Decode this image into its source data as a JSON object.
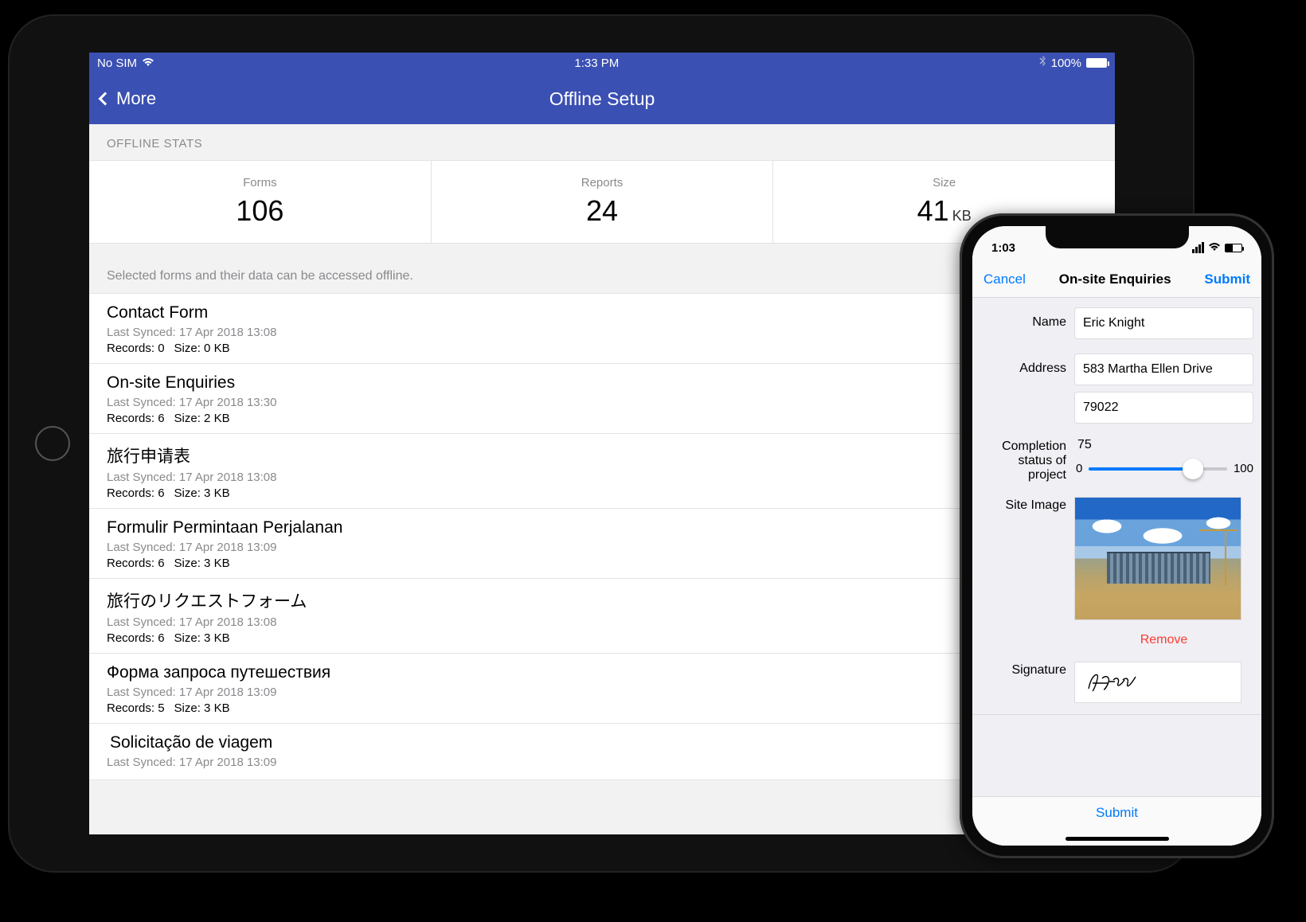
{
  "ipad": {
    "status": {
      "carrier": "No SIM",
      "time": "1:33 PM",
      "battery": "100%"
    },
    "nav": {
      "back": "More",
      "title": "Offline Setup"
    },
    "sectionHeader": "OFFLINE STATS",
    "stats": {
      "formsLabel": "Forms",
      "formsValue": "106",
      "reportsLabel": "Reports",
      "reportsValue": "24",
      "sizeLabel": "Size",
      "sizeValue": "41",
      "sizeUnit": "KB"
    },
    "helperText": "Selected forms and their data can be accessed offline.",
    "forms": [
      {
        "title": "Contact Form",
        "sync": "Last Synced: 17 Apr 2018 13:08",
        "records": "Records: 0",
        "size": "Size:   0 KB"
      },
      {
        "title": "On-site Enquiries",
        "sync": "Last Synced: 17 Apr 2018 13:30",
        "records": "Records: 6",
        "size": "Size:   2 KB"
      },
      {
        "title": "旅行申请表",
        "sync": "Last Synced: 17 Apr 2018 13:08",
        "records": "Records: 6",
        "size": "Size:   3 KB"
      },
      {
        "title": "Formulir Permintaan Perjalanan",
        "sync": "Last Synced: 17 Apr 2018 13:09",
        "records": "Records: 6",
        "size": "Size:   3 KB"
      },
      {
        "title": "旅行のリクエストフォーム",
        "sync": "Last Synced: 17 Apr 2018 13:08",
        "records": "Records: 6",
        "size": "Size:   3 KB"
      },
      {
        "title": "Форма запроса путешествия",
        "sync": "Last Synced: 17 Apr 2018 13:09",
        "records": "Records: 5",
        "size": "Size:   3 KB"
      },
      {
        "title": "Solicitação de viagem",
        "sync": "Last Synced: 17 Apr 2018 13:09",
        "records": "",
        "size": ""
      }
    ]
  },
  "iphone": {
    "status": {
      "time": "1:03"
    },
    "nav": {
      "cancel": "Cancel",
      "title": "On-site Enquiries",
      "submit": "Submit"
    },
    "fields": {
      "nameLabel": "Name",
      "nameValue": "Eric Knight",
      "addressLabel": "Address",
      "addressLine1": "583 Martha Ellen Drive",
      "addressLine2": "79022",
      "completionLabel": "Completion status of project",
      "completionValue": "75",
      "completionMin": "0",
      "completionMax": "100",
      "siteImageLabel": "Site Image",
      "removeLabel": "Remove",
      "signatureLabel": "Signature"
    },
    "bottom": {
      "submit": "Submit"
    }
  }
}
